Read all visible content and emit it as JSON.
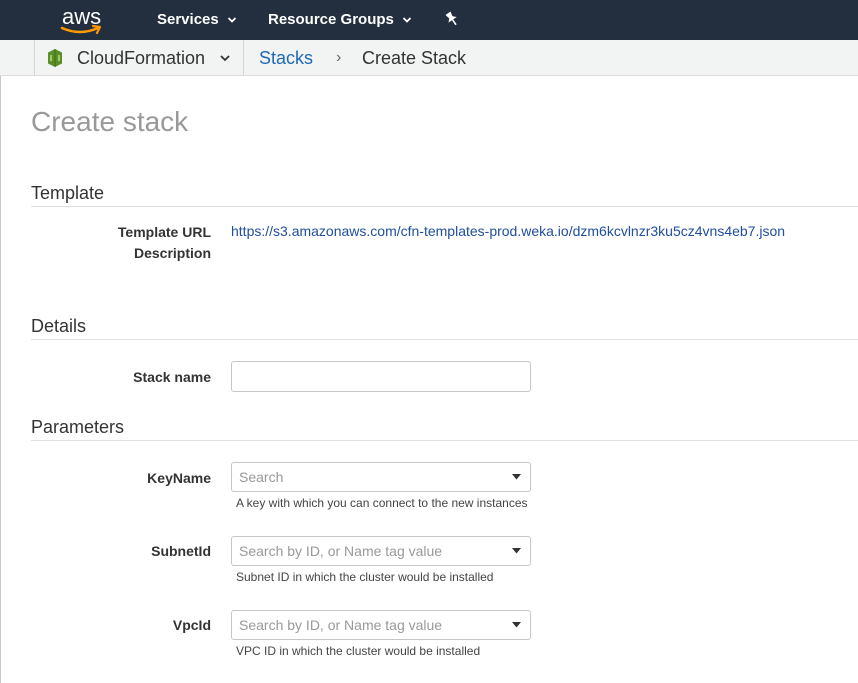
{
  "topnav": {
    "logo_text": "aws",
    "services_label": "Services",
    "resource_groups_label": "Resource Groups"
  },
  "breadcrumb": {
    "service": "CloudFormation",
    "stacks": "Stacks",
    "separator": "›",
    "current": "Create Stack"
  },
  "page": {
    "title": "Create stack"
  },
  "template": {
    "section_title": "Template",
    "url_label": "Template URL",
    "url_value": "https://s3.amazonaws.com/cfn-templates-prod.weka.io/dzm6kcvlnzr3ku5cz4vns4eb7.json",
    "description_label": "Description"
  },
  "details": {
    "section_title": "Details",
    "stack_name_label": "Stack name",
    "stack_name_value": ""
  },
  "parameters": {
    "section_title": "Parameters",
    "keyname": {
      "label": "KeyName",
      "placeholder": "Search",
      "help": "A key with which you can connect to the new instances"
    },
    "subnetid": {
      "label": "SubnetId",
      "placeholder": "Search by ID, or Name tag value",
      "help": "Subnet ID in which the cluster would be installed"
    },
    "vpcid": {
      "label": "VpcId",
      "placeholder": "Search by ID, or Name tag value",
      "help": "VPC ID in which the cluster would be installed"
    }
  },
  "colors": {
    "nav_bg": "#232f3e",
    "link": "#1f69b4",
    "aws_orange": "#ff9900"
  }
}
